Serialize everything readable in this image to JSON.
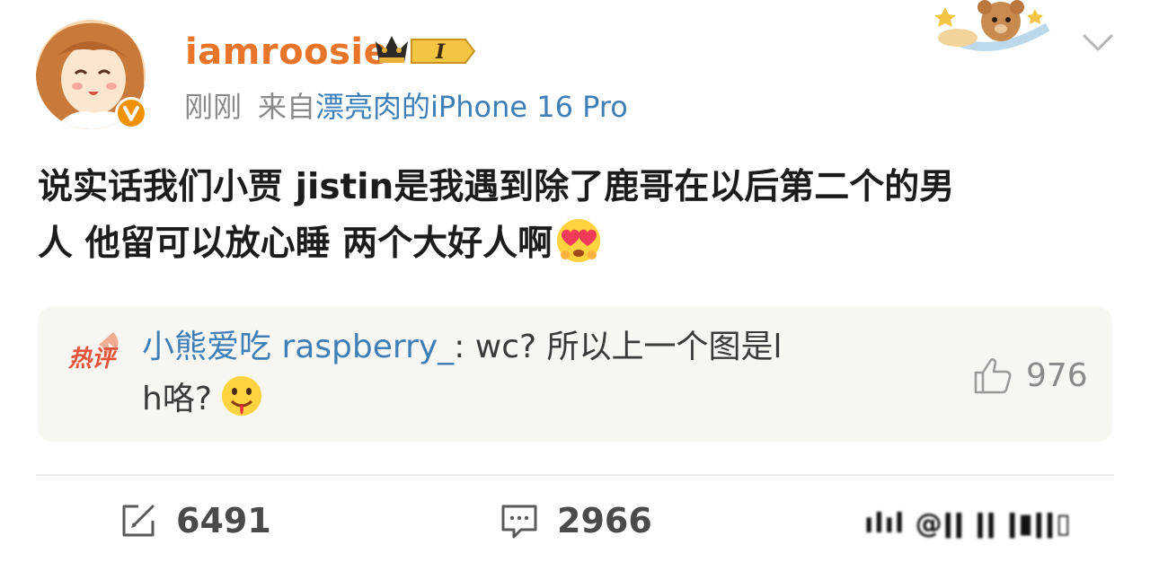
{
  "post": {
    "username": "iamroosie",
    "badge_text": "I",
    "time": "刚刚",
    "source_prefix": "来自",
    "source_device": "漂亮肉的iPhone 16 Pro",
    "text_line1": "说实话我们小贾 jistin是我遇到除了鹿哥在以后第二个的男",
    "text_line2": "人 他留可以放心睡 两个大好人啊",
    "emoji": "heart-eyes-emoji"
  },
  "hot_comment": {
    "label": "热评",
    "author": "小熊爱吃 raspberry_",
    "content_line1": ": wc?  所以上一个图是l",
    "content_line2": "h咯?",
    "emoji": "drooling-emoji",
    "likes": "976"
  },
  "actions": {
    "repost_count": "6491",
    "comment_count": "2966"
  },
  "watermark": "ılıl @ǀǀ ǀǀ ǀ▮ǀǀ▯",
  "colors": {
    "username": "#e8752a",
    "link": "#3f7fb8",
    "meta": "#8a8a8a",
    "comment_bg": "#f7f6f2",
    "verified": "#f39200"
  },
  "icons": [
    "verified-icon",
    "crown-badge-icon",
    "chevron-down-icon",
    "hot-comment-icon",
    "thumbs-up-icon",
    "repost-icon",
    "comment-icon"
  ]
}
